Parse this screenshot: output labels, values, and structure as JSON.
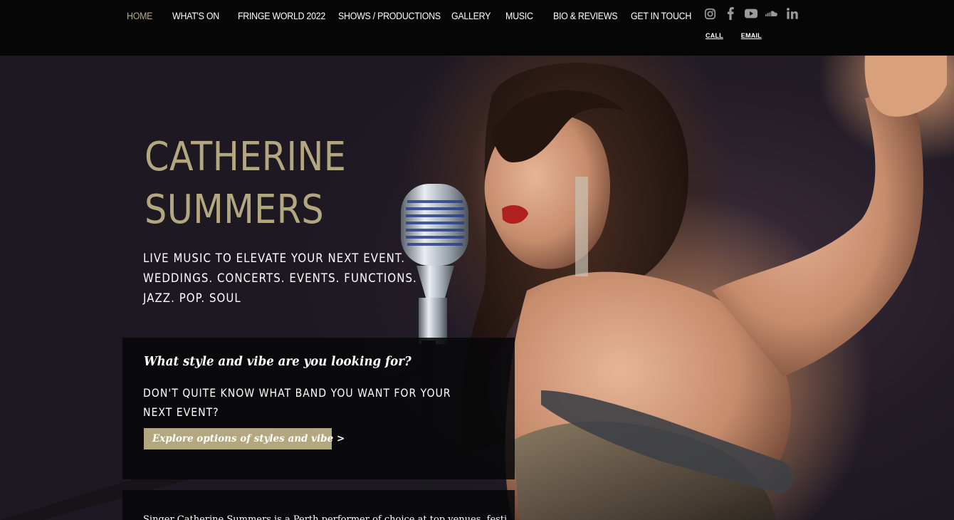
{
  "nav": {
    "items": [
      {
        "label": "HOME",
        "active": true
      },
      {
        "label": "WHAT'S ON",
        "active": false
      },
      {
        "label": "FRINGE WORLD 2022",
        "active": false
      },
      {
        "label": "SHOWS / PRODUCTIONS",
        "active": false
      },
      {
        "label": "GALLERY",
        "active": false
      },
      {
        "label": "MUSIC",
        "active": false
      },
      {
        "label": "BIO & REVIEWS",
        "active": false
      },
      {
        "label": "GET IN TOUCH",
        "active": false
      }
    ],
    "social_icons": [
      "instagram-icon",
      "facebook-icon",
      "youtube-icon",
      "soundcloud-icon",
      "linkedin-icon"
    ],
    "call_label": "CALL",
    "email_label": "EMAIL"
  },
  "hero": {
    "name_line1": "CATHERINE",
    "name_line2": "SUMMERS",
    "tagline_line1": "LIVE MUSIC TO ELEVATE YOUR NEXT EVENT.",
    "tagline_line2": "WEDDINGS. CONCERTS. EVENTS. FUNCTIONS.",
    "tagline_line3": "JAZZ. POP. SOUL"
  },
  "vibe": {
    "title": "What style and vibe are you looking for?",
    "text": "DON'T QUITE KNOW WHAT BAND YOU WANT FOR YOUR NEXT EVENT?",
    "button_label": "Explore options of styles and vibe >"
  },
  "bio": {
    "text": "Singer Catherine Summers is a Perth performer of choice at top venues, festivals"
  },
  "colors": {
    "accent": "#b3a77f",
    "active_nav": "#b6aa86",
    "topbar": "#060606",
    "text": "#ffffff"
  }
}
